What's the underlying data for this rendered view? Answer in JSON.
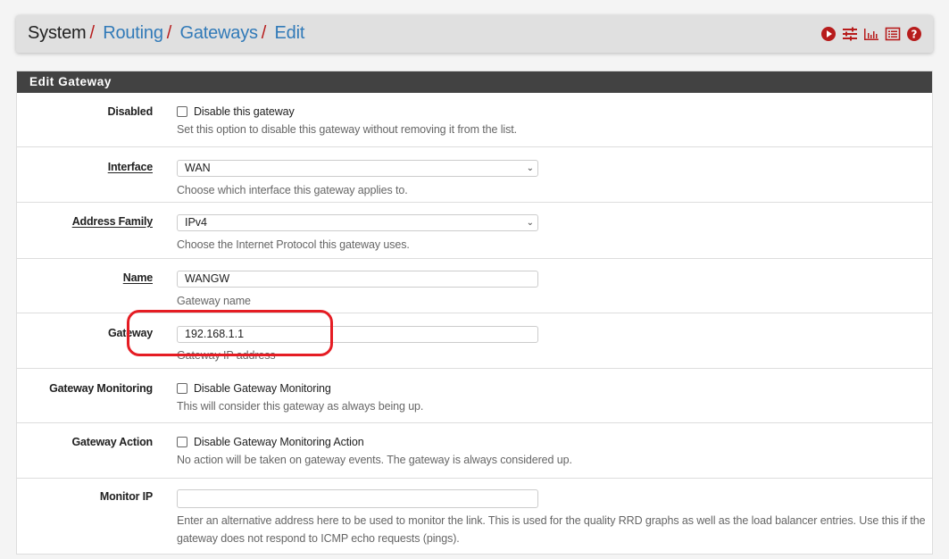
{
  "breadcrumb": {
    "items": [
      "System",
      "Routing",
      "Gateways",
      "Edit"
    ],
    "separator": "/"
  },
  "toolbar_icons": [
    {
      "name": "play-icon",
      "label": "Status"
    },
    {
      "name": "sliders-icon",
      "label": "Settings"
    },
    {
      "name": "chart-icon",
      "label": "Graphs"
    },
    {
      "name": "list-icon",
      "label": "Logs"
    },
    {
      "name": "help-icon",
      "label": "Help"
    }
  ],
  "colors": {
    "accent_red": "#b71c1c",
    "link_blue": "#317ab8",
    "panel_header": "#424242",
    "annotation": "#e51c23"
  },
  "panel": {
    "title": "Edit Gateway"
  },
  "fields": {
    "disabled": {
      "label": "Disabled",
      "checkbox_label": "Disable this gateway",
      "checked": false,
      "help": "Set this option to disable this gateway without removing it from the list."
    },
    "interface": {
      "label": "Interface",
      "value": "WAN",
      "help": "Choose which interface this gateway applies to."
    },
    "address_family": {
      "label": "Address Family",
      "value": "IPv4",
      "help": "Choose the Internet Protocol this gateway uses."
    },
    "name": {
      "label": "Name",
      "value": "WANGW",
      "help": "Gateway name"
    },
    "gateway": {
      "label": "Gateway",
      "value": "192.168.1.1",
      "help": "Gateway IP address"
    },
    "gateway_monitoring": {
      "label": "Gateway Monitoring",
      "checkbox_label": "Disable Gateway Monitoring",
      "checked": false,
      "help": "This will consider this gateway as always being up."
    },
    "gateway_action": {
      "label": "Gateway Action",
      "checkbox_label": "Disable Gateway Monitoring Action",
      "checked": false,
      "help": "No action will be taken on gateway events. The gateway is always considered up."
    },
    "monitor_ip": {
      "label": "Monitor IP",
      "value": "",
      "help": "Enter an alternative address here to be used to monitor the link. This is used for the quality RRD graphs as well as the load balancer entries. Use this if the gateway does not respond to ICMP echo requests (pings)."
    }
  }
}
